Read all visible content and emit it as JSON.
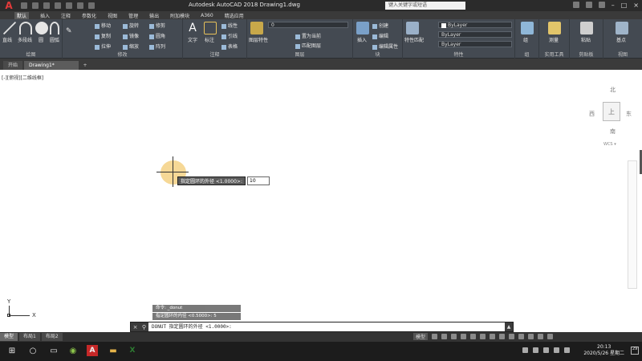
{
  "app": {
    "title": "Autodesk AutoCAD 2018    Drawing1.dwg",
    "logo_letter": "A",
    "search_placeholder": "键入关键字或短语"
  },
  "menu": {
    "tabs": [
      "默认",
      "插入",
      "注释",
      "参数化",
      "视图",
      "管理",
      "输出",
      "附加模块",
      "A360",
      "精选应用"
    ]
  },
  "ribbon": {
    "draw": {
      "label": "绘图",
      "line": "直线",
      "polyline": "多段线",
      "circle": "圆",
      "arc": "圆弧"
    },
    "modify": {
      "label": "修改",
      "move": "移动",
      "rotate": "旋转",
      "trim": "修剪",
      "copy": "复制",
      "mirror": "镜像",
      "fillet": "圆角",
      "stretch": "拉伸",
      "scale": "缩放",
      "array": "阵列"
    },
    "annotation": {
      "label": "注释",
      "text": "文字",
      "dimension": "标注",
      "linear": "线性",
      "leader": "引线",
      "table": "表格"
    },
    "layers": {
      "label": "图层",
      "layer_props": "图层特性",
      "layer_value": "0",
      "set_current": "置为当前",
      "match_layer": "匹配图层"
    },
    "block": {
      "label": "块",
      "insert": "插入",
      "create": "创建",
      "edit": "编辑",
      "edit_attr": "编辑属性"
    },
    "properties": {
      "label": "特性",
      "match": "特性匹配",
      "color": "ByLayer",
      "linetype": "ByLayer",
      "lineweight": "ByLayer"
    },
    "groups": {
      "label": "组",
      "group": "组"
    },
    "utilities": {
      "label": "实用工具",
      "measure": "测量"
    },
    "clipboard": {
      "label": "剪贴板",
      "paste": "粘贴"
    },
    "view": {
      "label": "视图",
      "base": "基点"
    }
  },
  "file_tabs": [
    "开始",
    "Drawing1*",
    "+"
  ],
  "viewport": {
    "label": "[-][俯视][二维线框]"
  },
  "viewcube": {
    "north": "北",
    "south": "南",
    "west": "西",
    "east": "东",
    "top": "上",
    "wcs": "WCS ▾"
  },
  "dynamic_input": {
    "prompt": "指定圆环的外径 <1.0000>:",
    "value": "10"
  },
  "ucs": {
    "x": "X",
    "y": "Y"
  },
  "command_history": [
    "命令: _donut",
    "指定圆环的内径 <0.5000>: 5"
  ],
  "command_line": {
    "text": "DONUT 指定圆环的外径 <1.0000>:"
  },
  "layout_tabs": [
    "模型",
    "布局1",
    "布局2"
  ],
  "status": {
    "model": "模型"
  },
  "taskbar": {
    "time": "20:13",
    "date": "2020/5/26 星期二",
    "notify_count": "29"
  },
  "colors": {
    "title_bar": "#2b2b2b",
    "ribbon": "#444a52",
    "highlight_circle": "#f0be50",
    "taskbar": "#1c1c1c"
  }
}
